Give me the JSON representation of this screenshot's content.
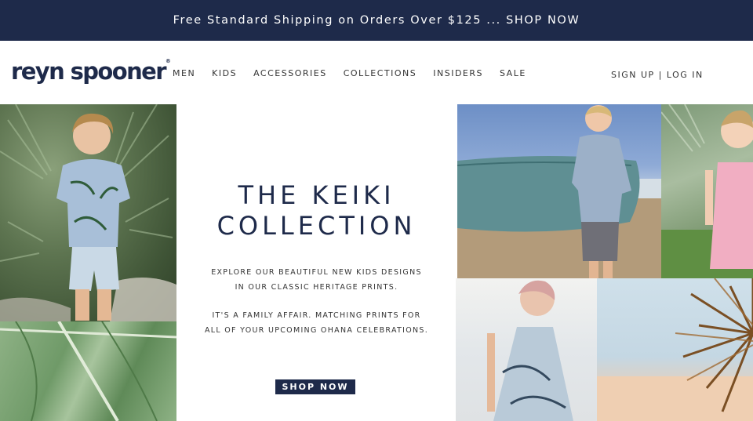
{
  "announcement": {
    "text": "Free Standard Shipping on Orders Over $125 ... SHOP NOW"
  },
  "header": {
    "logo": "reyn spooner",
    "logo_mark": "®",
    "nav": [
      "MEN",
      "KIDS",
      "ACCESSORIES",
      "COLLECTIONS",
      "INSIDERS",
      "SALE"
    ],
    "sign_up": "SIGN UP",
    "divider": "|",
    "log_in": "LOG IN"
  },
  "hero": {
    "headline_1": "THE KEIKI",
    "headline_2": "COLLECTION",
    "paragraph_1_line_1": "EXPLORE OUR BEAUTIFUL NEW KIDS DESIGNS",
    "paragraph_1_line_2": "IN OUR CLASSIC HERITAGE PRINTS.",
    "paragraph_2_line_1": "IT'S A FAMILY AFFAIR. MATCHING PRINTS FOR",
    "paragraph_2_line_2": "ALL OF YOUR UPCOMING OHANA CELEBRATIONS.",
    "cta": "SHOP NOW"
  },
  "colors": {
    "brand_navy": "#1e2a4a",
    "text": "#333333",
    "background": "#ffffff"
  }
}
